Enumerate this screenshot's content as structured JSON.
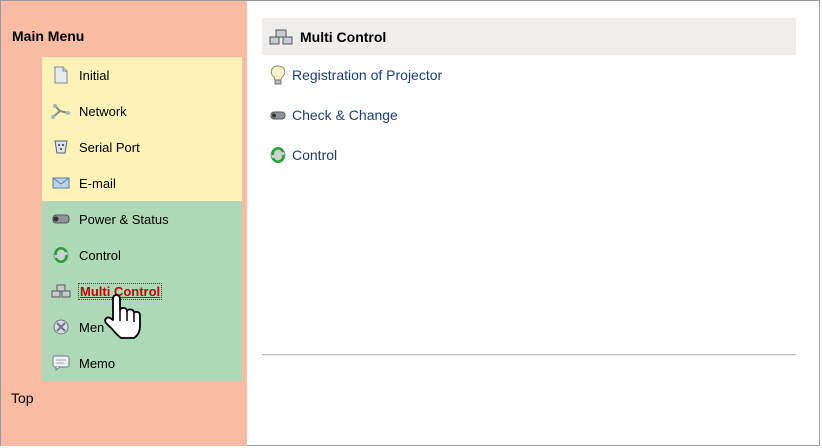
{
  "sidebar": {
    "title": "Main Menu",
    "groups": [
      {
        "color": "#fdf2b8",
        "items": [
          {
            "label": "Initial",
            "icon": "page-icon"
          },
          {
            "label": "Network",
            "icon": "network-icon"
          },
          {
            "label": "Serial Port",
            "icon": "serial-port-icon"
          },
          {
            "label": "E-mail",
            "icon": "email-icon"
          }
        ]
      },
      {
        "color": "#aed9b8",
        "items": [
          {
            "label": "Power & Status",
            "icon": "projector-icon"
          },
          {
            "label": "Control",
            "icon": "control-icon"
          },
          {
            "label": "Multi Control",
            "icon": "multi-projector-icon",
            "active": true
          },
          {
            "label": "Men",
            "icon": "menu-icon"
          },
          {
            "label": "Memo",
            "icon": "memo-icon"
          }
        ]
      }
    ],
    "top_link": "Top",
    "background": "#f8bba3"
  },
  "content": {
    "title": "Multi Control",
    "links": [
      {
        "label": "Registration of Projector",
        "icon": "lightbulb-icon"
      },
      {
        "label": "Check & Change",
        "icon": "projector-icon"
      },
      {
        "label": "Control",
        "icon": "control-icon"
      }
    ]
  },
  "colors": {
    "link": "#1d3f70",
    "active": "#c00000",
    "header_bg": "#f0eeed"
  }
}
